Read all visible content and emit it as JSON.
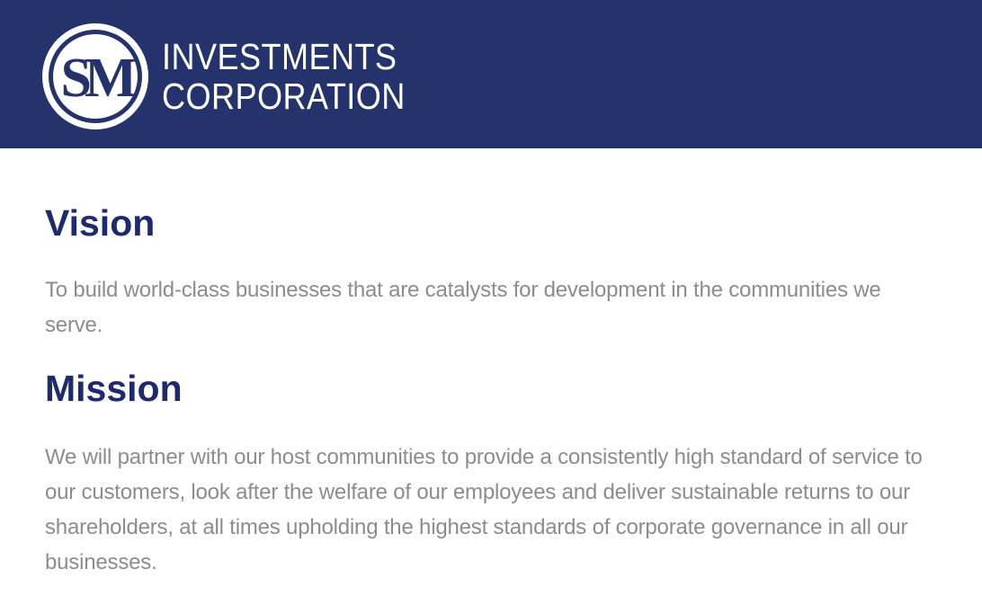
{
  "brand": {
    "logo_mark": "SM",
    "line1": "INVESTMENTS",
    "line2": "CORPORATION",
    "header_color": "#24336b"
  },
  "sections": [
    {
      "heading": "Vision",
      "text": "To build world-class businesses that are catalysts for development in the communities we serve."
    },
    {
      "heading": "Mission",
      "text": "We will partner with our host communities to provide a consistently high standard of service to our customers, look after the welfare of our employees and deliver sustainable returns to our shareholders, at all times upholding the highest standards of corporate governance in all our businesses."
    }
  ]
}
